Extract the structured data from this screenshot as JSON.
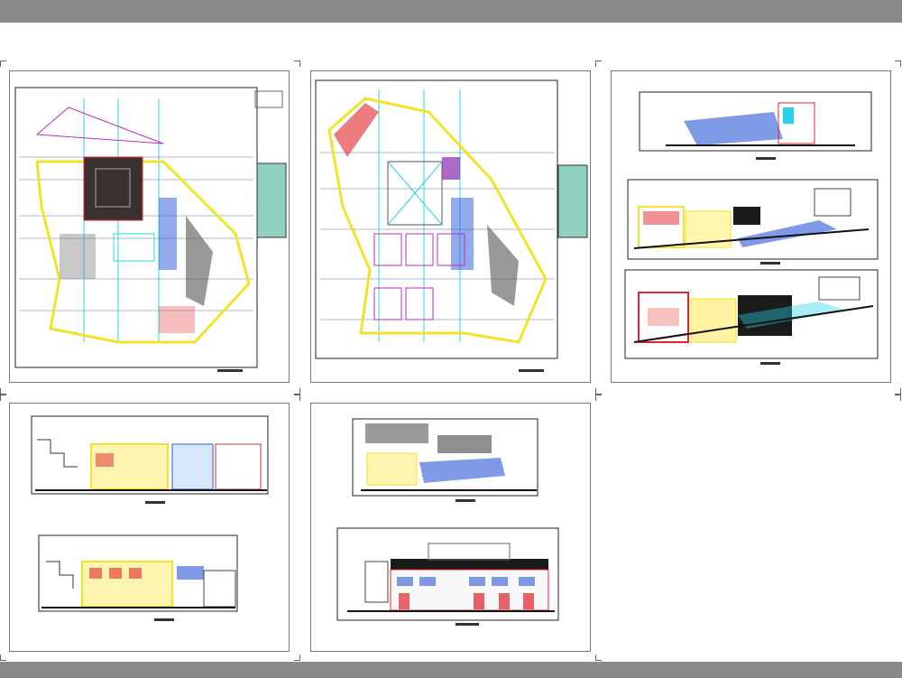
{
  "viewer": {
    "sheet_count": 5
  },
  "sheets": [
    {
      "name": "floor-plan-1",
      "kind": "plan"
    },
    {
      "name": "floor-plan-2",
      "kind": "plan"
    },
    {
      "name": "sections-1",
      "kind": "sections"
    },
    {
      "name": "sections-2",
      "kind": "sections"
    },
    {
      "name": "section-elevation",
      "kind": "elevation"
    }
  ],
  "colors": {
    "toolbar": "#8a8a8a",
    "outline": "#222222",
    "yellow": "#f2e22a",
    "cyan": "#27d3e8",
    "red": "#e0242c",
    "blue": "#2a58d8",
    "magenta": "#c02bc0",
    "dark": "#1a1a1a",
    "grid": "#4a7a8a"
  }
}
